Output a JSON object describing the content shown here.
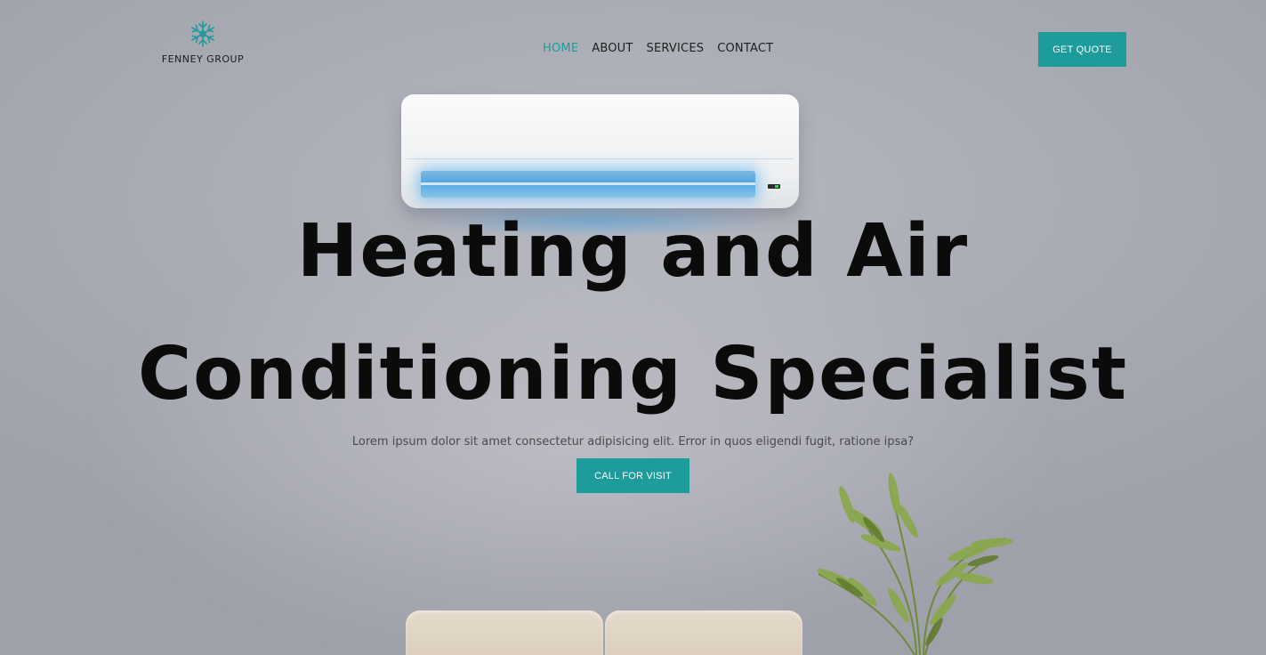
{
  "brand": {
    "logo_icon": "snowflake-icon",
    "name": "FENNEY GROUP",
    "accent_color": "#1e9b9b"
  },
  "nav": {
    "items": [
      {
        "label": "HOME",
        "active": true
      },
      {
        "label": "ABOUT",
        "active": false
      },
      {
        "label": "SERVICES",
        "active": false
      },
      {
        "label": "CONTACT",
        "active": false
      }
    ],
    "cta_label": "GET QUOTE"
  },
  "hero": {
    "title_line1": "Heating and Air",
    "title_line2": "Conditioning Specialist",
    "subtitle": "Lorem ipsum dolor sit amet consectetur adipisicing elit. Error in quos eligendi fugit, ratione ipsa?",
    "cta_label": "CALL FOR VISIT"
  },
  "imagery": {
    "air_conditioner": "air-conditioner-illustration",
    "plant": "potted-plant-illustration",
    "sofa": "sofa-illustration"
  }
}
